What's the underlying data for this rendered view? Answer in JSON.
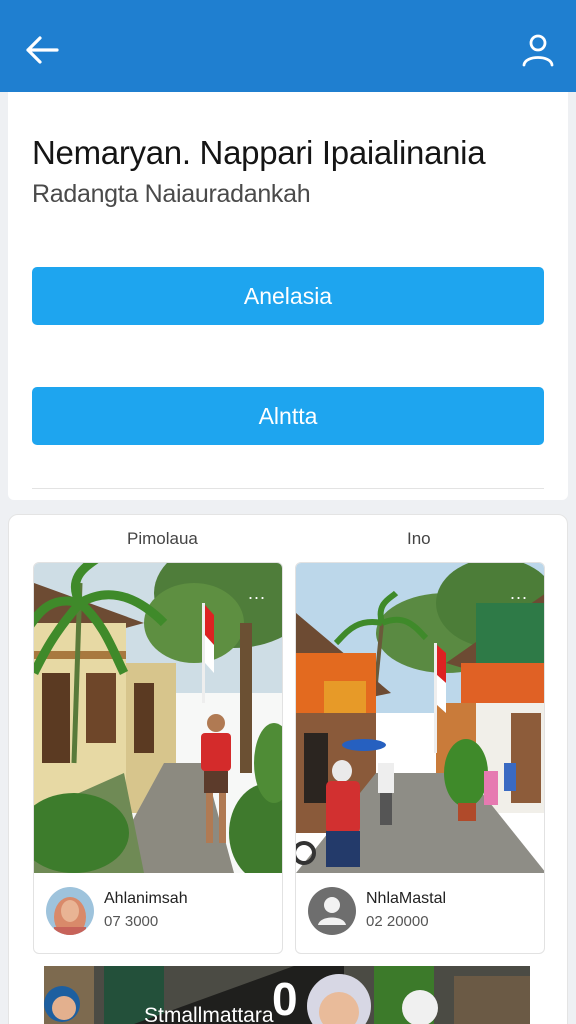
{
  "header": {
    "back_icon": "arrow-left-icon",
    "profile_icon": "user-icon"
  },
  "main": {
    "title": "Nemaryan. Nappari Ipaialinania",
    "subtitle": "Radangta Naiauradankah",
    "primary_button": "Anelasia",
    "secondary_button": "Alntta",
    "button_color": "#1ea5ef"
  },
  "feed": {
    "tabs": [
      "Pimolaua",
      "Ino"
    ],
    "posts": [
      {
        "username": "Ahlanimsah",
        "count": "07 3000",
        "more_label": "..."
      },
      {
        "username": "NhlaMastal",
        "count": "02 20000",
        "more_label": "..."
      }
    ]
  },
  "strip": {
    "text": "Stmallmattara",
    "number": "0"
  },
  "colors": {
    "topbar": "#1f7fd0",
    "accent": "#1ea5ef"
  }
}
